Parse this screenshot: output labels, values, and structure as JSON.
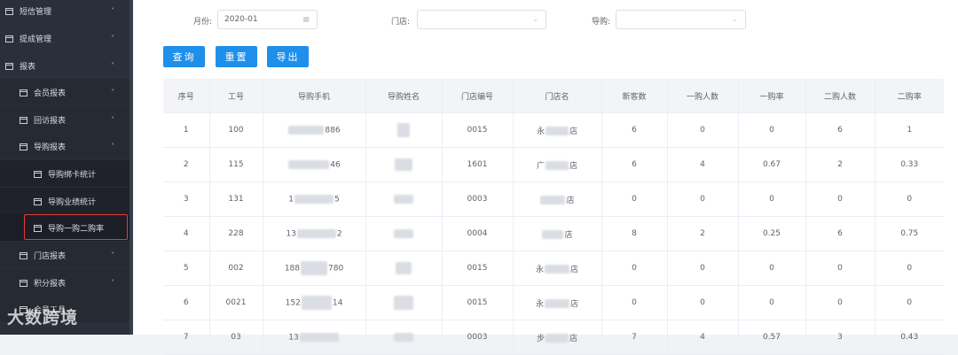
{
  "sidebar": {
    "items": [
      {
        "label": "短信管理",
        "chevron": "˅"
      },
      {
        "label": "提成管理",
        "chevron": "˅"
      },
      {
        "label": "报表",
        "chevron": "˄"
      },
      {
        "label": "会员报表",
        "chevron": "˅"
      },
      {
        "label": "回访报表",
        "chevron": "˅"
      },
      {
        "label": "导购报表",
        "chevron": "˄"
      },
      {
        "label": "导购绑卡统计"
      },
      {
        "label": "导购业绩统计"
      },
      {
        "label": "导购一购二购率"
      },
      {
        "label": "门店报表",
        "chevron": "˅"
      },
      {
        "label": "积分报表",
        "chevron": "˅"
      },
      {
        "label": "会员工具"
      }
    ]
  },
  "filters": {
    "month_label": "月份:",
    "month_value": "2020-01",
    "store_label": "门店:",
    "guide_label": "导购:"
  },
  "buttons": {
    "query": "查询",
    "reset": "重置",
    "export": "导出"
  },
  "table": {
    "headers": [
      "序号",
      "工号",
      "导购手机",
      "导购姓名",
      "门店编号",
      "门店名",
      "新客数",
      "一购人数",
      "一购率",
      "二购人数",
      "二购率"
    ],
    "rows": [
      {
        "no": "1",
        "id": "100",
        "phone_a": "",
        "phone_b": "886",
        "store_no": "0015",
        "store_a": "永",
        "store_b": "店",
        "new": "6",
        "buy1": "0",
        "rate1": "0",
        "buy2": "6",
        "rate2": "1"
      },
      {
        "no": "2",
        "id": "115",
        "phone_a": "",
        "phone_b": "46",
        "store_no": "1601",
        "store_a": "广",
        "store_b": "店",
        "new": "6",
        "buy1": "4",
        "rate1": "0.67",
        "buy2": "2",
        "rate2": "0.33"
      },
      {
        "no": "3",
        "id": "131",
        "phone_a": "1",
        "phone_b": "5",
        "store_no": "0003",
        "store_a": "",
        "store_b": "店",
        "new": "0",
        "buy1": "0",
        "rate1": "0",
        "buy2": "0",
        "rate2": "0"
      },
      {
        "no": "4",
        "id": "228",
        "phone_a": "13",
        "phone_b": "2",
        "store_no": "0004",
        "store_a": "",
        "store_b": "店",
        "new": "8",
        "buy1": "2",
        "rate1": "0.25",
        "buy2": "6",
        "rate2": "0.75"
      },
      {
        "no": "5",
        "id": "002",
        "phone_a": "188",
        "phone_b": "780",
        "store_no": "0015",
        "store_a": "永",
        "store_b": "店",
        "new": "0",
        "buy1": "0",
        "rate1": "0",
        "buy2": "0",
        "rate2": "0"
      },
      {
        "no": "6",
        "id": "0021",
        "phone_a": "152",
        "phone_b": "14",
        "store_no": "0015",
        "store_a": "永",
        "store_b": "店",
        "new": "0",
        "buy1": "0",
        "rate1": "0",
        "buy2": "0",
        "rate2": "0"
      },
      {
        "no": "7",
        "id": "03",
        "phone_a": "13",
        "phone_b": "",
        "store_no": "0003",
        "store_a": "步",
        "store_b": "店",
        "new": "7",
        "buy1": "4",
        "rate1": "0.57",
        "buy2": "3",
        "rate2": "0.43"
      }
    ]
  },
  "watermark": "大数跨境",
  "colors": {
    "sidebar_bg": "#2b2f3a",
    "primary": "#1e8fea",
    "highlight_border": "#e53935"
  }
}
